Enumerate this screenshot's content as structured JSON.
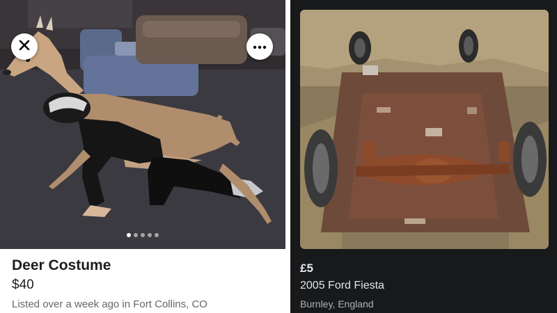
{
  "left_listing": {
    "title": "Deer Costume",
    "price": "$40",
    "meta": "Listed over a week ago in Fort Collins, CO",
    "close_icon": "close-icon",
    "more_icon": "more-options-icon",
    "photo_count": 5,
    "active_photo_index": 0
  },
  "right_listing": {
    "price": "£5",
    "title": "2005 Ford Fiesta",
    "location": "Burnley, England"
  },
  "colors": {
    "left_background": "#ffffff",
    "right_background": "#18191a",
    "primary_text_light": "#1c1e21",
    "secondary_text_light": "#65676b",
    "primary_text_dark": "#e4e6eb",
    "secondary_text_dark": "#b0b3b8"
  }
}
